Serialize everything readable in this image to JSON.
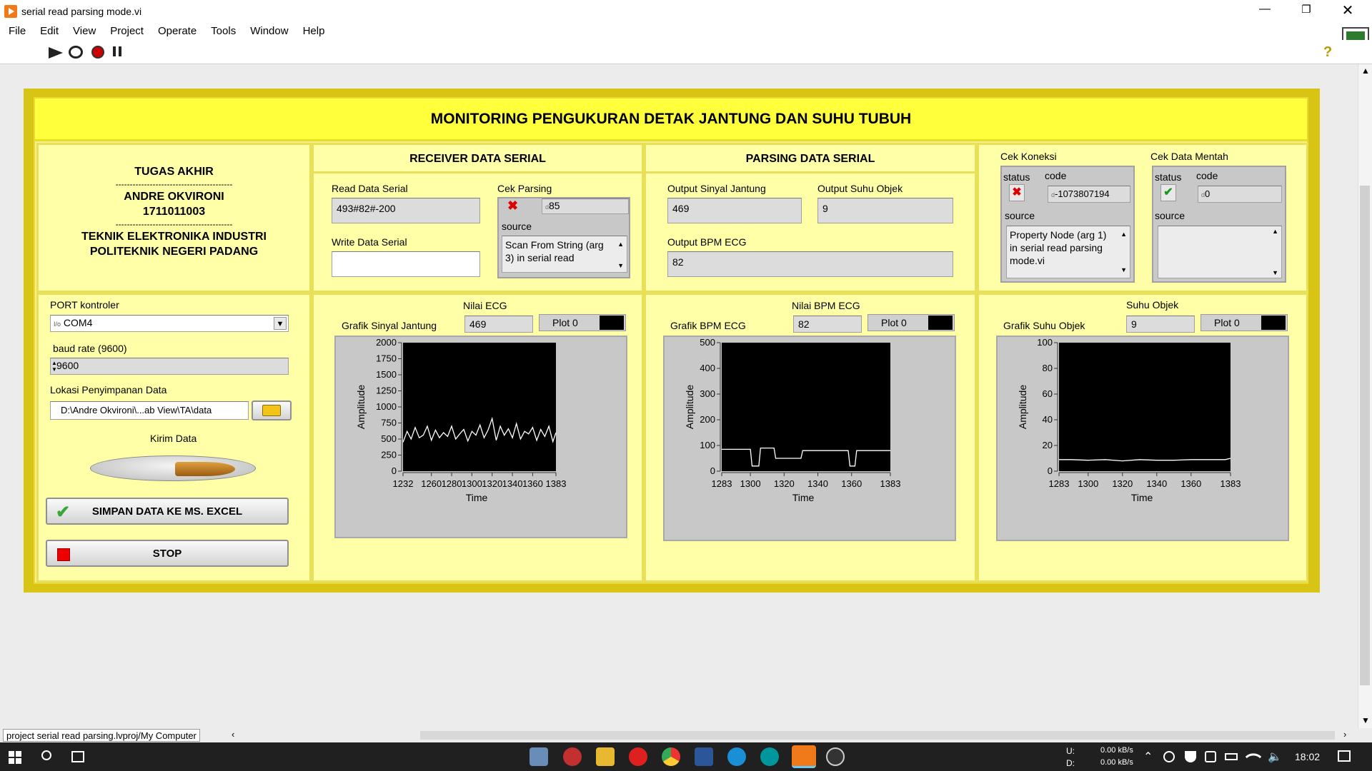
{
  "window": {
    "title": "serial read parsing mode.vi"
  },
  "menu": [
    "File",
    "Edit",
    "View",
    "Project",
    "Operate",
    "Tools",
    "Window",
    "Help"
  ],
  "banner": "MONITORING PENGUKURAN DETAK JANTUNG DAN SUHU TUBUH",
  "info": {
    "line1": "TUGAS AKHIR",
    "dash": "-----------------------------------------",
    "name": "ANDRE OKVIRONI",
    "nim": "1711011003",
    "dept": "TEKNIK ELEKTRONIKA INDUSTRI",
    "school": "POLITEKNIK NEGERI PADANG"
  },
  "controls": {
    "port_label": "PORT kontroler",
    "port_value": "COM4",
    "port_prefix": "I/o",
    "baud_label": "baud rate (9600)",
    "baud_value": "9600",
    "path_label": "Lokasi Penyimpanan Data",
    "path_value": "D:\\Andre Okvironi\\...ab View\\TA\\data",
    "kirim_label": "Kirim Data",
    "save_button": "SIMPAN DATA KE MS. EXCEL",
    "stop_button": "STOP"
  },
  "receiver": {
    "title": "RECEIVER DATA SERIAL",
    "read_label": "Read Data Serial",
    "read_value": "493#82#-200",
    "write_label": "Write Data Serial",
    "write_value": "",
    "cek_label": "Cek Parsing",
    "cek_code": "85",
    "cek_code_prefix": "d",
    "source_label": "source",
    "source_value": "Scan From String (arg 3) in serial read"
  },
  "parsing": {
    "title": "PARSING DATA SERIAL",
    "jantung_label": "Output Sinyal Jantung",
    "jantung_value": "469",
    "suhu_label": "Output Suhu Objek",
    "suhu_value": "9",
    "bpm_label": "Output BPM ECG",
    "bpm_value": "82"
  },
  "koneksi": {
    "title": "Cek Koneksi",
    "status_label": "status",
    "code_label": "code",
    "code_value": "-1073807194",
    "code_prefix": "d",
    "source_label": "source",
    "source_value": "Property Node (arg 1) in serial read parsing mode.vi"
  },
  "mentah": {
    "title": "Cek Data Mentah",
    "status_label": "status",
    "code_label": "code",
    "code_value": "0",
    "code_prefix": "d",
    "source_label": "source",
    "source_value": ""
  },
  "graphs": {
    "ecg": {
      "title": "Grafik Sinyal Jantung",
      "value_label": "Nilai ECG",
      "value": "469",
      "legend": "Plot 0",
      "ylabel": "Amplitude",
      "xlabel": "Time"
    },
    "bpm": {
      "title": "Grafik BPM ECG",
      "value_label": "Nilai BPM ECG",
      "value": "82",
      "legend": "Plot 0",
      "ylabel": "Amplitude",
      "xlabel": "Time"
    },
    "suhu": {
      "title": "Grafik Suhu Objek",
      "value_label": "Suhu Objek",
      "value": "9",
      "legend": "Plot 0",
      "ylabel": "Amplitude",
      "xlabel": "Time"
    }
  },
  "chart_data": [
    {
      "type": "line",
      "title": "Grafik Sinyal Jantung",
      "xlabel": "Time",
      "ylabel": "Amplitude",
      "xlim": [
        1232,
        1383
      ],
      "ylim": [
        0,
        2000
      ],
      "xticks": [
        1232,
        1260,
        1280,
        1300,
        1320,
        1340,
        1360,
        1383
      ],
      "yticks": [
        0,
        250,
        500,
        750,
        1000,
        1250,
        1500,
        1750,
        2000
      ],
      "series": [
        {
          "name": "Plot 0",
          "x": [
            1232,
            1236,
            1240,
            1244,
            1248,
            1252,
            1256,
            1260,
            1264,
            1268,
            1272,
            1276,
            1280,
            1284,
            1288,
            1292,
            1296,
            1300,
            1304,
            1308,
            1312,
            1316,
            1320,
            1324,
            1328,
            1332,
            1336,
            1340,
            1344,
            1348,
            1352,
            1356,
            1360,
            1364,
            1368,
            1372,
            1376,
            1380,
            1383
          ],
          "values": [
            450,
            620,
            500,
            680,
            520,
            560,
            700,
            480,
            640,
            520,
            600,
            540,
            700,
            500,
            580,
            650,
            470,
            620,
            560,
            720,
            520,
            640,
            820,
            480,
            700,
            560,
            660,
            520,
            740,
            500,
            620,
            580,
            680,
            480,
            650,
            540,
            700,
            460,
            600
          ]
        }
      ]
    },
    {
      "type": "line",
      "title": "Grafik BPM ECG",
      "xlabel": "Time",
      "ylabel": "Amplitude",
      "xlim": [
        1283,
        1383
      ],
      "ylim": [
        0,
        500
      ],
      "xticks": [
        1283,
        1300,
        1320,
        1340,
        1360,
        1383
      ],
      "yticks": [
        0,
        100,
        200,
        300,
        400,
        500
      ],
      "series": [
        {
          "name": "Plot 0",
          "x": [
            1283,
            1292,
            1300,
            1301,
            1302,
            1305,
            1306,
            1308,
            1314,
            1315,
            1320,
            1324,
            1330,
            1331,
            1340,
            1350,
            1358,
            1359,
            1360,
            1362,
            1363,
            1366,
            1383
          ],
          "values": [
            85,
            85,
            85,
            20,
            20,
            20,
            90,
            90,
            90,
            50,
            50,
            50,
            50,
            80,
            80,
            80,
            80,
            20,
            20,
            20,
            80,
            80,
            80
          ]
        }
      ]
    },
    {
      "type": "line",
      "title": "Grafik Suhu Objek",
      "xlabel": "Time",
      "ylabel": "Amplitude",
      "xlim": [
        1283,
        1383
      ],
      "ylim": [
        0,
        100
      ],
      "xticks": [
        1283,
        1300,
        1320,
        1340,
        1360,
        1383
      ],
      "yticks": [
        0,
        20,
        40,
        60,
        80,
        100
      ],
      "series": [
        {
          "name": "Plot 0",
          "x": [
            1283,
            1290,
            1300,
            1310,
            1320,
            1330,
            1340,
            1350,
            1360,
            1370,
            1380,
            1383
          ],
          "values": [
            9,
            9,
            8.5,
            9,
            8,
            9,
            8.5,
            8.5,
            9,
            9,
            9,
            10
          ]
        }
      ]
    }
  ],
  "statusbar": {
    "project": "project serial read parsing.lvproj/My Computer"
  },
  "taskbar": {
    "time": "18:02",
    "net_up_label": "U:",
    "net_down_label": "D:",
    "net_up": "0.00 kB/s",
    "net_down": "0.00 kB/s"
  },
  "colors": {
    "frame": "#d8c415",
    "panel": "#ffffa8",
    "banner": "#ffff3c",
    "plot_bg": "#000000",
    "plot_line": "#ffffff"
  }
}
